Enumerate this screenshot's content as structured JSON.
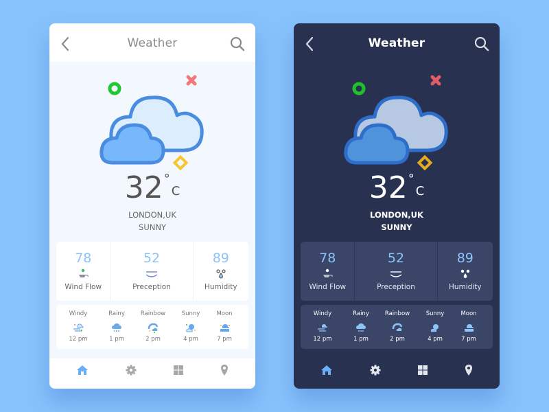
{
  "theme_colors": {
    "page_background": "#86c2fb",
    "accent_blue": "#8cc4f8",
    "dark_card": "#283150",
    "dark_panel": "#3a4568",
    "light_body": "#f3f8fe",
    "decor_green": "#22c833",
    "decor_red": "#f27979",
    "decor_yellow": "#f7c531"
  },
  "screens": [
    {
      "variant": "light",
      "header": {
        "back_icon": "chevron-left-icon",
        "title": "Weather",
        "search_icon": "search-icon"
      },
      "hero": {
        "icon": "cloudy-icon"
      },
      "temperature": {
        "value": "32",
        "degree_symbol": "°",
        "unit": "C"
      },
      "location": "LONDON,UK",
      "condition": "SUNNY",
      "stats": [
        {
          "value": "78",
          "label": "Wind Flow",
          "icon": "wind-icon"
        },
        {
          "value": "52",
          "label": "Preception",
          "icon": "waves-icon"
        },
        {
          "value": "89",
          "label": "Humidity",
          "icon": "droplets-icon"
        }
      ],
      "forecast": [
        {
          "name": "Windy",
          "time": "12 pm",
          "icon": "windy-cloud-icon"
        },
        {
          "name": "Rainy",
          "time": "1 pm",
          "icon": "rain-cloud-icon"
        },
        {
          "name": "Rainbow",
          "time": "2 pm",
          "icon": "rainbow-icon"
        },
        {
          "name": "Sunny",
          "time": "4 pm",
          "icon": "sun-cloud-icon"
        },
        {
          "name": "Moon",
          "time": "7 pm",
          "icon": "moon-cloud-icon"
        }
      ],
      "nav": [
        {
          "name": "home",
          "icon": "home-icon",
          "active": true
        },
        {
          "name": "settings",
          "icon": "gear-icon",
          "active": false
        },
        {
          "name": "grid",
          "icon": "grid-icon",
          "active": false
        },
        {
          "name": "location",
          "icon": "map-pin-icon",
          "active": false
        }
      ]
    },
    {
      "variant": "dark",
      "header": {
        "back_icon": "chevron-left-icon",
        "title": "Weather",
        "search_icon": "search-icon"
      },
      "hero": {
        "icon": "cloudy-icon"
      },
      "temperature": {
        "value": "32",
        "degree_symbol": "°",
        "unit": "C"
      },
      "location": "LONDON,UK",
      "condition": "SUNNY",
      "stats": [
        {
          "value": "78",
          "label": "Wind Flow",
          "icon": "wind-icon"
        },
        {
          "value": "52",
          "label": "Preception",
          "icon": "waves-icon"
        },
        {
          "value": "89",
          "label": "Humidity",
          "icon": "droplets-icon"
        }
      ],
      "forecast": [
        {
          "name": "Windy",
          "time": "12 pm",
          "icon": "windy-cloud-icon"
        },
        {
          "name": "Rainy",
          "time": "1 pm",
          "icon": "rain-cloud-icon"
        },
        {
          "name": "Rainbow",
          "time": "2 pm",
          "icon": "rainbow-icon"
        },
        {
          "name": "Sunny",
          "time": "4 pm",
          "icon": "sun-cloud-icon"
        },
        {
          "name": "Moon",
          "time": "7 pm",
          "icon": "moon-cloud-icon"
        }
      ],
      "nav": [
        {
          "name": "home",
          "icon": "home-icon",
          "active": true
        },
        {
          "name": "settings",
          "icon": "gear-icon",
          "active": false
        },
        {
          "name": "grid",
          "icon": "grid-icon",
          "active": false
        },
        {
          "name": "location",
          "icon": "map-pin-icon",
          "active": false
        }
      ]
    }
  ]
}
